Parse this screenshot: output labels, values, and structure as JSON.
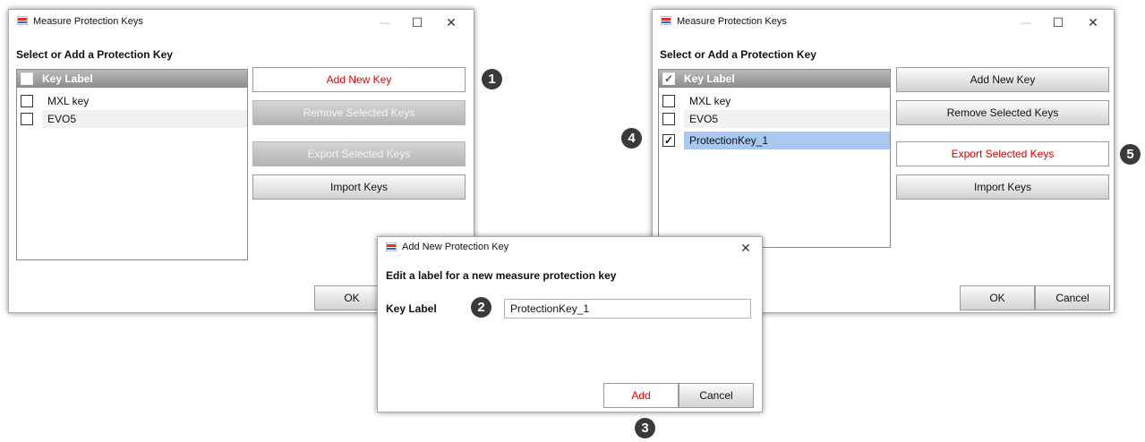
{
  "dialog_left": {
    "title": "Measure Protection Keys",
    "heading": "Select or Add a Protection Key",
    "list_header": "Key Label",
    "rows": [
      {
        "label": "MXL key",
        "checked": ""
      },
      {
        "label": "EVO5",
        "checked": ""
      }
    ],
    "buttons": {
      "add": "Add New Key",
      "remove": "Remove Selected Keys",
      "export": "Export Selected Keys",
      "import": "Import Keys",
      "ok": "OK"
    }
  },
  "dialog_right": {
    "title": "Measure Protection Keys",
    "heading": "Select or Add a Protection Key",
    "list_header": "Key Label",
    "header_check": "✓",
    "rows": [
      {
        "label": "MXL key",
        "checked": ""
      },
      {
        "label": "EVO5",
        "checked": ""
      },
      {
        "label": "ProtectionKey_1",
        "checked": "✓"
      }
    ],
    "buttons": {
      "add": "Add New Key",
      "remove": "Remove Selected Keys",
      "export": "Export Selected Keys",
      "import": "Import Keys",
      "ok": "OK",
      "cancel": "Cancel"
    }
  },
  "dialog_add": {
    "title": "Add New Protection Key",
    "instruction": "Edit a label for a new measure protection key",
    "field_label": "Key Label",
    "field_value": "ProtectionKey_1",
    "buttons": {
      "add": "Add",
      "cancel": "Cancel"
    }
  },
  "window_controls": {
    "minimize": "—",
    "maximize": "☐",
    "close": "✕"
  },
  "callouts": [
    "1",
    "2",
    "3",
    "4",
    "5"
  ],
  "colors": {
    "accent_red": "#e00000",
    "selection": "#a9c8ef",
    "badge": "#3a3a3a"
  }
}
